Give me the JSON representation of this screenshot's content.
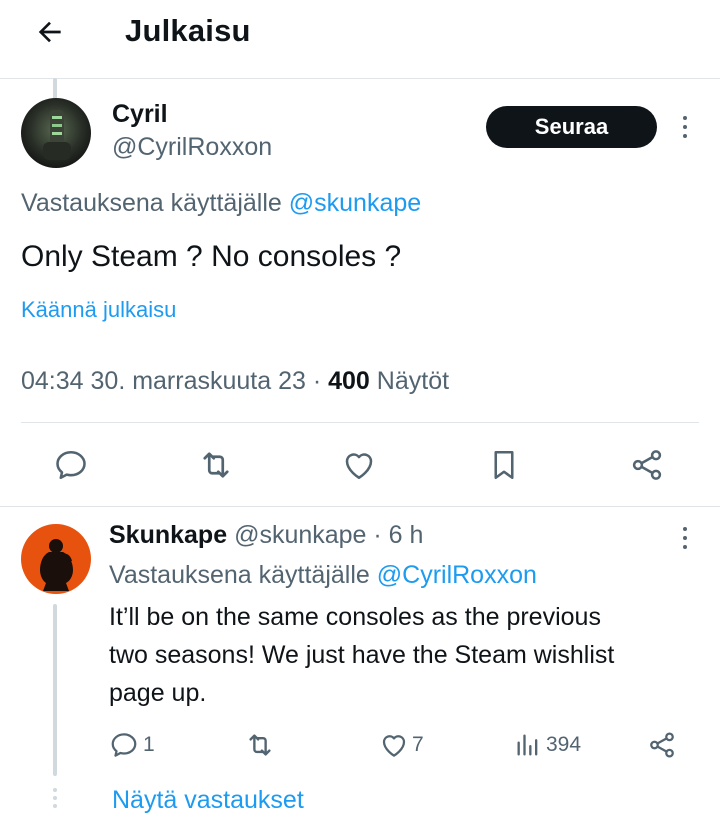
{
  "header": {
    "title": "Julkaisu"
  },
  "main_post": {
    "author_name": "Cyril",
    "author_handle": "@CyrilRoxxon",
    "follow_label": "Seuraa",
    "reply_prefix": "Vastauksena käyttäjälle",
    "reply_to": "@skunkape",
    "text": "Only Steam ? No consoles ?",
    "translate_label": "Käännä julkaisu",
    "time": "04:34 30. marraskuuta 23 · ",
    "views_count": "400",
    "views_label": "Näytöt"
  },
  "reply": {
    "author_name": "Skunkape",
    "meta": "@skunkape · 6 h",
    "reply_prefix": "Vastauksena käyttäjälle",
    "reply_to": "@CyrilRoxxon",
    "text_line1": "It’ll be on the same consoles as the previous",
    "text_line2": "two seasons! We just have the Steam wishlist",
    "text_line3": "page up.",
    "reply_count": "1",
    "like_count": "7",
    "view_count": "394",
    "show_replies_label": "Näytä vastaukset"
  },
  "icons": {
    "back": "arrow-left-icon",
    "reply": "speech-bubble-icon",
    "repost": "repost-icon",
    "like": "heart-icon",
    "bookmark": "bookmark-icon",
    "share": "share-icon",
    "views": "bar-chart-icon",
    "more": "vertical-dots-icon"
  },
  "colors": {
    "text": "#0f1419",
    "muted": "#536471",
    "link": "#1d9bf0",
    "border": "#e1e5e8",
    "button": "#0f1419"
  }
}
